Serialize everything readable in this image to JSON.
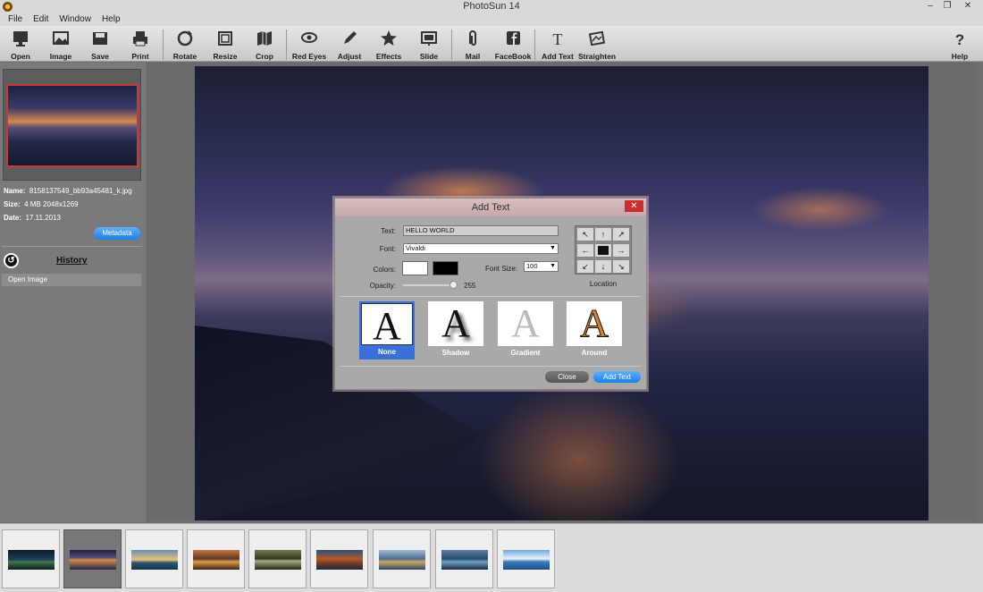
{
  "app": {
    "title": "PhotoSun 14",
    "minimize": "–",
    "restore": "❐",
    "close": "✕"
  },
  "menu": [
    "File",
    "Edit",
    "Window",
    "Help"
  ],
  "toolbar": {
    "items": [
      {
        "id": "open",
        "label": "Open",
        "icon": "monitor-icon"
      },
      {
        "id": "image",
        "label": "Image",
        "icon": "image-icon"
      },
      {
        "id": "save",
        "label": "Save",
        "icon": "save-icon"
      },
      {
        "id": "print",
        "label": "Print",
        "icon": "printer-icon"
      },
      {
        "id": "rotate",
        "label": "Rotate",
        "icon": "rotate-icon"
      },
      {
        "id": "resize",
        "label": "Resize",
        "icon": "resize-icon"
      },
      {
        "id": "crop",
        "label": "Crop",
        "icon": "crop-icon"
      },
      {
        "id": "redeyes",
        "label": "Red Eyes",
        "icon": "eye-icon"
      },
      {
        "id": "adjust",
        "label": "Adjust",
        "icon": "pencil-icon"
      },
      {
        "id": "effects",
        "label": "Effects",
        "icon": "star-icon"
      },
      {
        "id": "slide",
        "label": "Slide",
        "icon": "slideshow-icon"
      },
      {
        "id": "mail",
        "label": "Mail",
        "icon": "paperclip-icon"
      },
      {
        "id": "facebook",
        "label": "FaceBook",
        "icon": "facebook-icon"
      },
      {
        "id": "addtext",
        "label": "Add Text",
        "icon": "text-icon"
      },
      {
        "id": "straighten",
        "label": "Straighten",
        "icon": "straighten-icon"
      },
      {
        "id": "help",
        "label": "Help",
        "icon": "help-icon"
      }
    ]
  },
  "left": {
    "name_label": "Name:",
    "name_value": "8158137549_bb93a45481_k.jpg",
    "size_label": "Size:",
    "size_value": "4 MB  2048x1269",
    "date_label": "Date:",
    "date_value": "17.11.2013",
    "metadata_button": "Metadata",
    "history_title": "History",
    "history_items": [
      "Open Image"
    ]
  },
  "dialog": {
    "title": "Add Text",
    "close": "✕",
    "text_label": "Text:",
    "text_value": "HELLO WORLD",
    "font_label": "Font:",
    "font_value": "Vivaldi",
    "colors_label": "Colors:",
    "color_fore": "#ffffff",
    "color_back": "#000000",
    "fontsize_label": "Font Size:",
    "fontsize_value": "100",
    "opacity_label": "Opacity:",
    "opacity_value": "255",
    "opacity_fraction": 1.0,
    "location_label": "Location",
    "location_arrows": [
      "↖",
      "↑",
      "↗",
      "←",
      "",
      "→",
      "↙",
      "↓",
      "↘"
    ],
    "styles": [
      {
        "name": "None",
        "glyph": "A",
        "active": true
      },
      {
        "name": "Shadow",
        "glyph": "A",
        "active": false
      },
      {
        "name": "Gradient",
        "glyph": "A",
        "active": false
      },
      {
        "name": "Around",
        "glyph": "A",
        "active": false
      }
    ],
    "close_button": "Close",
    "add_button": "Add Text"
  },
  "filmstrip": {
    "count": 9,
    "selected_index": 1
  },
  "colors": {
    "accent": "#1a7fe6",
    "dialog_close": "#c9302c"
  }
}
